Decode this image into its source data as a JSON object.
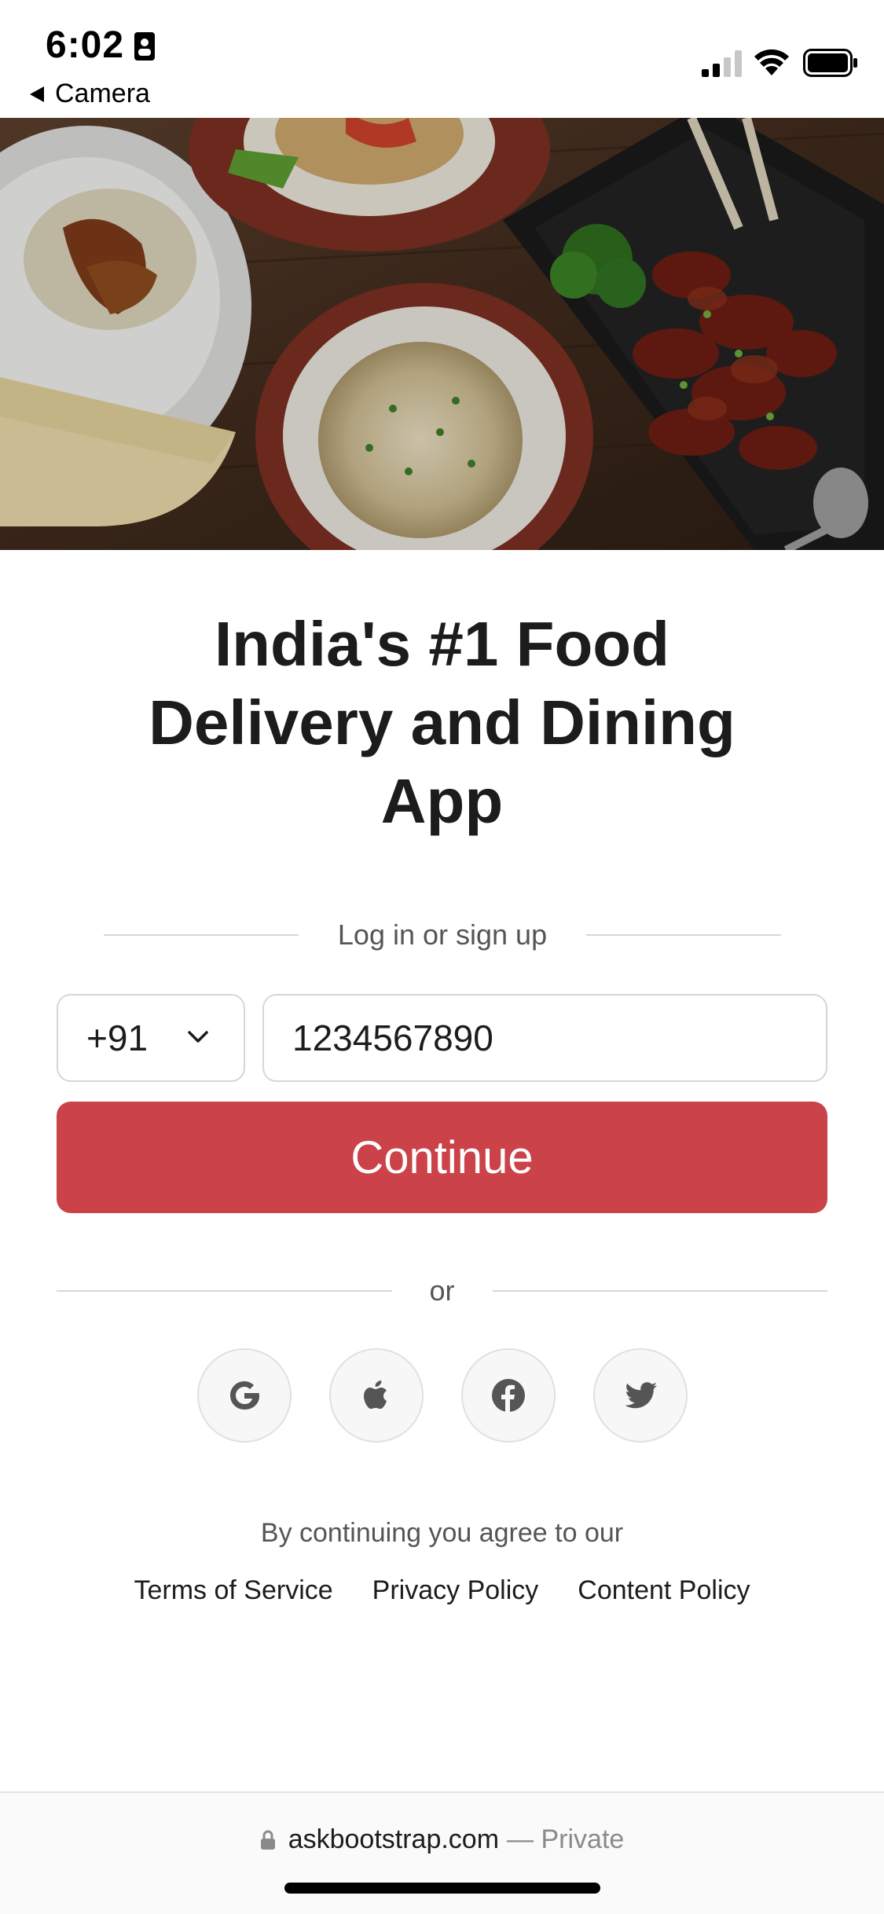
{
  "status_bar": {
    "time": "6:02",
    "back_label": "Camera"
  },
  "hero": {
    "image_alt": "food dishes on table"
  },
  "headline": "India's #1 Food Delivery and Dining App",
  "login": {
    "divider_text": "Log in or sign up",
    "country_code": "+91",
    "phone_value": "1234567890",
    "continue_label": "Continue",
    "or_text": "or"
  },
  "social": [
    {
      "name": "google",
      "icon": "google-icon"
    },
    {
      "name": "apple",
      "icon": "apple-icon"
    },
    {
      "name": "facebook",
      "icon": "facebook-icon"
    },
    {
      "name": "twitter",
      "icon": "twitter-icon"
    }
  ],
  "legal": {
    "agree_text": "By continuing you agree to our",
    "terms": "Terms of Service",
    "privacy": "Privacy Policy",
    "content": "Content Policy"
  },
  "browser": {
    "url": "askbootstrap.com",
    "mode": "— Private"
  },
  "colors": {
    "accent": "#cb4249",
    "text": "#1c1c1c",
    "muted": "#555555"
  }
}
